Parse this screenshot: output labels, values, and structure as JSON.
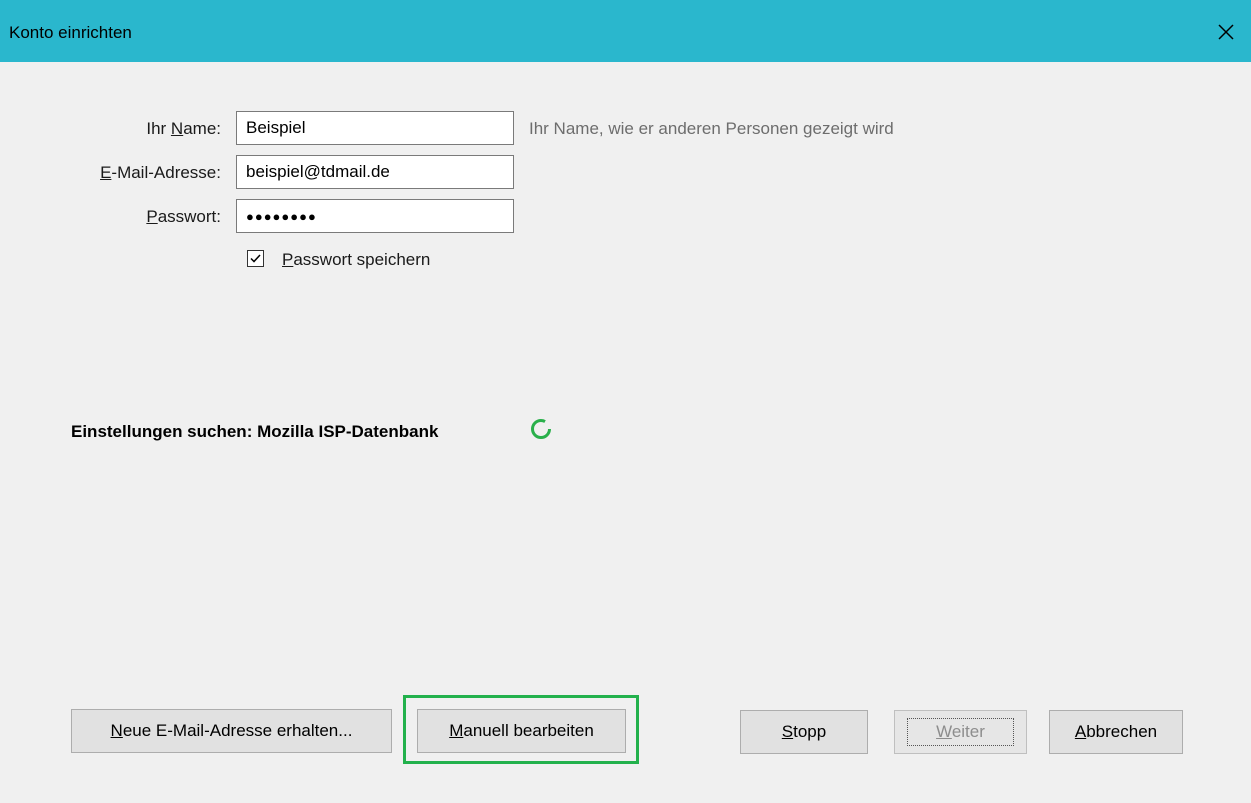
{
  "window": {
    "title": "Konto einrichten",
    "close_icon": "close-icon"
  },
  "form": {
    "name_label_pre": "Ihr ",
    "name_label_u": "N",
    "name_label_post": "ame:",
    "name_value": "Beispiel",
    "name_hint": "Ihr Name, wie er anderen Personen gezeigt wird",
    "email_label_u": "E",
    "email_label_post": "-Mail-Adresse:",
    "email_value": "beispiel@tdmail.de",
    "password_label_u": "P",
    "password_label_post": "asswort:",
    "password_value": "●●●●●●●●",
    "remember_u": "P",
    "remember_post": "asswort speichern",
    "remember_checked": true
  },
  "status": {
    "text": "Einstellungen suchen: Mozilla ISP-Datenbank",
    "spinner_icon": "loading-spinner-icon",
    "spinner_color": "#2ab04b"
  },
  "buttons": {
    "new_email_u": "N",
    "new_email_post": "eue E-Mail-Adresse erhalten...",
    "manual_u": "M",
    "manual_post": "anuell bearbeiten",
    "stop_u": "S",
    "stop_post": "topp",
    "next_u": "W",
    "next_post": "eiter",
    "cancel_u": "A",
    "cancel_post": "bbrechen"
  },
  "colors": {
    "titlebar": "#2ab7cd",
    "highlight": "#22b14c"
  }
}
